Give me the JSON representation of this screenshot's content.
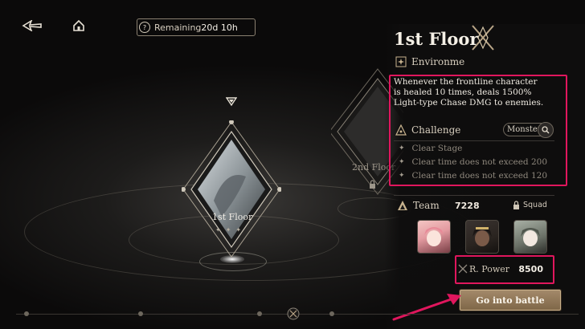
{
  "header": {
    "remaining_label": "Remaining",
    "remaining_value": "20d 10h",
    "help_glyph": "?"
  },
  "map": {
    "floors": [
      {
        "label": "1st Floor",
        "state": "selected"
      },
      {
        "label": "2nd Floor",
        "state": "locked"
      }
    ]
  },
  "panel": {
    "title": "1st Floor",
    "environment_heading": "Environme",
    "environment_text": "Whenever the frontline character is healed 10 times, deals 1500% Light-type Chase DMG to enemies.",
    "challenge_heading": "Challenge",
    "monster_label": "Monster",
    "conditions": [
      "Clear Stage",
      "Clear time does not exceed 200",
      "Clear time does not exceed 120"
    ],
    "team_heading": "Team",
    "team_value": "7228",
    "squad_label": "Squad",
    "power_label": "R. Power",
    "power_value": "8500",
    "battle_button": "Go into battle"
  },
  "colors": {
    "highlight": "#e0165d",
    "accent_gold": "#a3896a",
    "background": "#0d0c0c"
  },
  "icons": [
    "back-arrow-icon",
    "home-icon",
    "help-icon",
    "environment-icon",
    "challenge-icon",
    "search-icon",
    "team-icon",
    "lock-icon",
    "chevron-down-icon",
    "power-icon",
    "emblem-icon"
  ]
}
